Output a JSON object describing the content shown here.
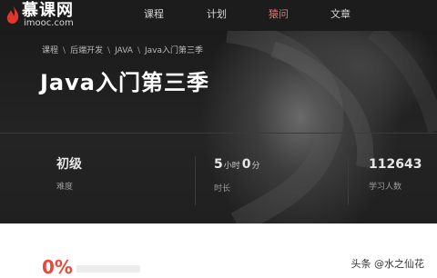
{
  "logo": {
    "main": "慕课网",
    "sub": "imooc.com"
  },
  "nav": [
    {
      "label": "课程",
      "active": false
    },
    {
      "label": "计划",
      "active": false
    },
    {
      "label": "猿问",
      "active": true
    },
    {
      "label": "文章",
      "active": false
    }
  ],
  "breadcrumb": [
    "课程",
    "后端开发",
    "JAVA",
    "Java入门第三季"
  ],
  "breadcrumb_separator": "\\",
  "course": {
    "title": "Java入门第三季"
  },
  "stats": {
    "difficulty": {
      "value": "初级",
      "label": "难度"
    },
    "duration": {
      "hours": "5",
      "hours_unit": "小时",
      "minutes": "0",
      "minutes_unit": "分",
      "label": "时长"
    },
    "learners": {
      "value": "112643",
      "label": "学习人数"
    }
  },
  "progress": {
    "value": "0%"
  },
  "watermark": "头条 @水之仙花",
  "colors": {
    "nav_bg": "#1c1c1c",
    "active_nav": "#e07a7a",
    "accent": "#e84a3a"
  }
}
